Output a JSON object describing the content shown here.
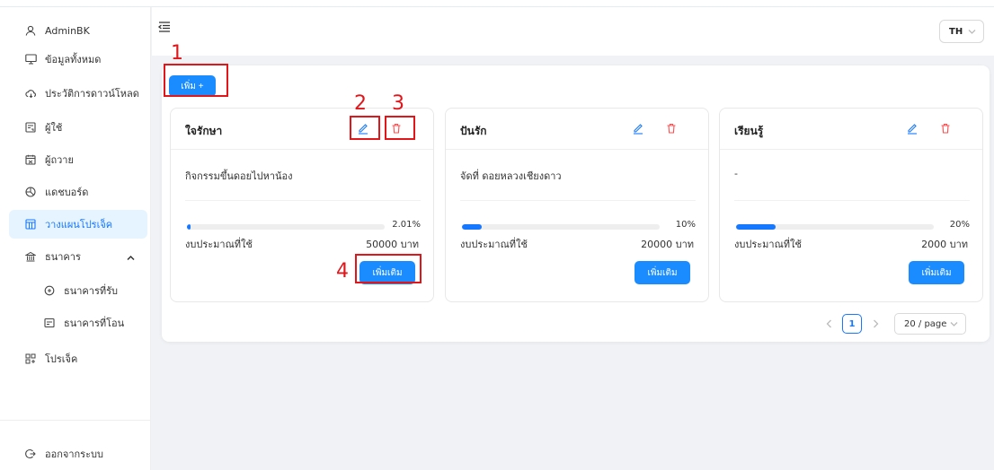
{
  "sidebar": {
    "user": "AdminBK",
    "items": [
      {
        "label": "ข้อมูลทั้งหมด",
        "icon": "monitor-icon"
      },
      {
        "label": "ประวัติการดาวน์โหลด",
        "icon": "cloud-icon"
      },
      {
        "label": "ผู้ใช้",
        "icon": "id-card-icon"
      },
      {
        "label": "ผู้ถวาย",
        "icon": "calendar-icon"
      },
      {
        "label": "แดชบอร์ด",
        "icon": "dashboard-icon"
      },
      {
        "label": "วางแผนโปรเจ็ค",
        "icon": "layout-icon",
        "active": true
      },
      {
        "label": "ธนาคาร",
        "icon": "bank-icon"
      }
    ],
    "bank_sub": [
      {
        "label": "ธนาคารที่รับ",
        "icon": "receive-icon"
      },
      {
        "label": "ธนาคารที่โอน",
        "icon": "transfer-icon"
      }
    ],
    "project": {
      "label": "โปรเจ็ค",
      "icon": "project-icon"
    },
    "logout": "ออกจากระบบ"
  },
  "header": {
    "language": "TH"
  },
  "toolbar": {
    "add_label": "เพิ่ม +"
  },
  "cards": [
    {
      "title": "ใจรักษา",
      "description": "กิจกรรมขึ้นดอยไปหาน้อง",
      "progress_text": "2.01%",
      "progress": 2.01,
      "budget_label": "งบประมาณที่ใช้",
      "budget_value": "50000 บาท",
      "more_label": "เพิ่มเติม"
    },
    {
      "title": "ปันรัก",
      "description": "จัดที่ ดอยหลวงเชียงดาว",
      "progress_text": "10%",
      "progress": 10,
      "budget_label": "งบประมาณที่ใช้",
      "budget_value": "20000 บาท",
      "more_label": "เพิ่มเติม"
    },
    {
      "title": "เรียนรู้",
      "description": "-",
      "progress_text": "20%",
      "progress": 20,
      "budget_label": "งบประมาณที่ใช้",
      "budget_value": "2000 บาท",
      "more_label": "เพิ่มเติม"
    }
  ],
  "pagination": {
    "current": "1",
    "page_size": "20 / page"
  },
  "annotations": [
    "1",
    "2",
    "3",
    "4"
  ],
  "colors": {
    "primary": "#1677ff",
    "danger": "#ff4d4f",
    "annotation": "#e0161b"
  }
}
